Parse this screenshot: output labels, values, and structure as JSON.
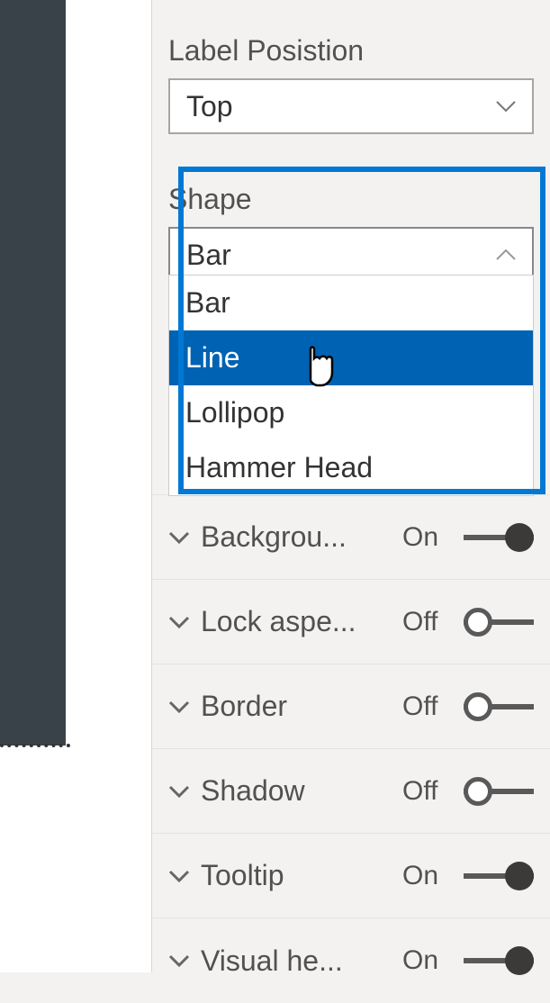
{
  "labelPosition": {
    "label": "Label Posistion",
    "value": "Top"
  },
  "shape": {
    "label": "Shape",
    "value": "Bar",
    "options": [
      "Bar",
      "Line",
      "Lollipop",
      "Hammer Head"
    ],
    "highlightedIndex": 1
  },
  "toggleRows": [
    {
      "label": "Backgrou...",
      "state": "On",
      "on": true
    },
    {
      "label": "Lock aspe...",
      "state": "Off",
      "on": false
    },
    {
      "label": "Border",
      "state": "Off",
      "on": false
    },
    {
      "label": "Shadow",
      "state": "Off",
      "on": false
    },
    {
      "label": "Tooltip",
      "state": "On",
      "on": true
    },
    {
      "label": "Visual he...",
      "state": "On",
      "on": true
    }
  ]
}
